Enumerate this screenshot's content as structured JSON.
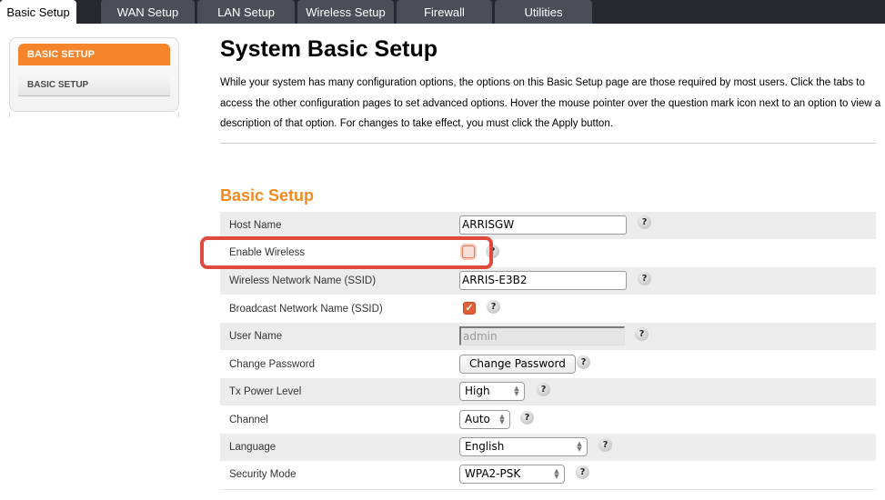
{
  "tabs": [
    {
      "label": "Basic Setup",
      "active": true
    },
    {
      "label": "WAN Setup",
      "active": false
    },
    {
      "label": "LAN Setup",
      "active": false
    },
    {
      "label": "Wireless Setup",
      "active": false
    },
    {
      "label": "Firewall",
      "active": false
    },
    {
      "label": "Utilities",
      "active": false
    }
  ],
  "sidebar": {
    "header": "BASIC SETUP",
    "items": [
      {
        "label": "BASIC SETUP"
      }
    ]
  },
  "page": {
    "title": "System Basic Setup",
    "intro": "While your system has many configuration options, the options on this Basic Setup page are those required by most users. Click the tabs to access the other configuration pages to set advanced options. Hover the mouse pointer over the question mark icon next to an option to view a description of that option. For changes to take effect, you must click the Apply button.",
    "section_title": "Basic Setup",
    "help_glyph": "?",
    "check_glyph": "✓"
  },
  "form": {
    "host_name": {
      "label": "Host Name",
      "value": "ARRISGW"
    },
    "enable_wireless": {
      "label": "Enable Wireless",
      "checked": false
    },
    "ssid": {
      "label": "Wireless Network Name (SSID)",
      "value": "ARRIS-E3B2"
    },
    "broadcast_ssid": {
      "label": "Broadcast Network Name (SSID)",
      "checked": true
    },
    "user_name": {
      "label": "User Name",
      "value": "admin",
      "disabled": true
    },
    "change_password": {
      "label": "Change Password",
      "button_label": "Change Password"
    },
    "tx_power": {
      "label": "Tx Power Level",
      "selected": "High"
    },
    "channel": {
      "label": "Channel",
      "selected": "Auto"
    },
    "language": {
      "label": "Language",
      "selected": "English"
    },
    "security_mode": {
      "label": "Security Mode",
      "selected": "WPA2-PSK"
    }
  },
  "colors": {
    "accent_orange": "#f5842a",
    "section_title": "#f28a1e",
    "highlight_red": "#e04a3c",
    "tab_bg": "#4a4e57",
    "tabbar_bg": "#25292e"
  }
}
